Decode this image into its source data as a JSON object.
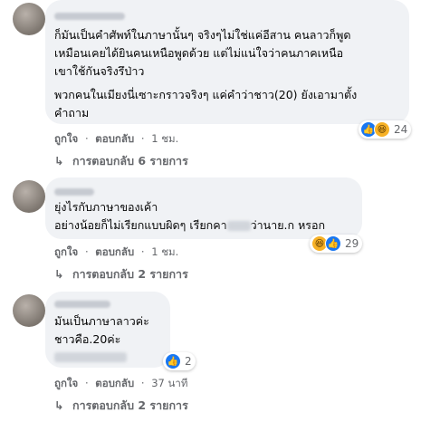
{
  "comments": [
    {
      "body": [
        "ก็มันเป็นคำศัพท์ในภาษานั้นๆ จริงๆไม่ใช่แค่อีสาน คนลาวก็พูด",
        "เหมือนเคยได้ยินคนเหนือพูดด้วย แต่ไม่แน่ใจว่าคนภาคเหนือ",
        "เขาใช้กันจริงรึป่าว",
        "พวกคนในเมียงนี่เซาะกราวจริงๆ แค่คำว่าชาว(20) ยังเอามาตั้ง",
        "คำถาม"
      ],
      "like": "ถูกใจ",
      "reply": "ตอบกลับ",
      "time": "1 ชม.",
      "reaction_count": "24",
      "reactions": [
        "like-icon",
        "haha-icon"
      ],
      "view_replies": "การตอบกลับ 6 รายการ"
    },
    {
      "body": [
        "ยุ่งไรกับภาษาของเค้า",
        "อย่างน้อยก็ไม่เรียกแบบผิดๆ เรียกคา",
        "ว่านาย.ก หรอก"
      ],
      "like": "ถูกใจ",
      "reply": "ตอบกลับ",
      "time": "1 ชม.",
      "reaction_count": "29",
      "reactions": [
        "haha-icon",
        "like-icon"
      ],
      "view_replies": "การตอบกลับ 2 รายการ"
    },
    {
      "body": [
        "มันเป็นภาษาลาวค่ะ",
        "ชาวคือ.20ค่ะ"
      ],
      "like": "ถูกใจ",
      "reply": "ตอบกลับ",
      "time": "37 นาที",
      "reaction_count": "2",
      "reactions": [
        "like-icon"
      ],
      "view_replies": "การตอบกลับ 2 รายการ"
    }
  ],
  "separator": "·",
  "colors": {
    "like": "#1877f2",
    "haha": "#f7b125",
    "bubble": "#f0f2f5",
    "meta": "#65676b"
  }
}
